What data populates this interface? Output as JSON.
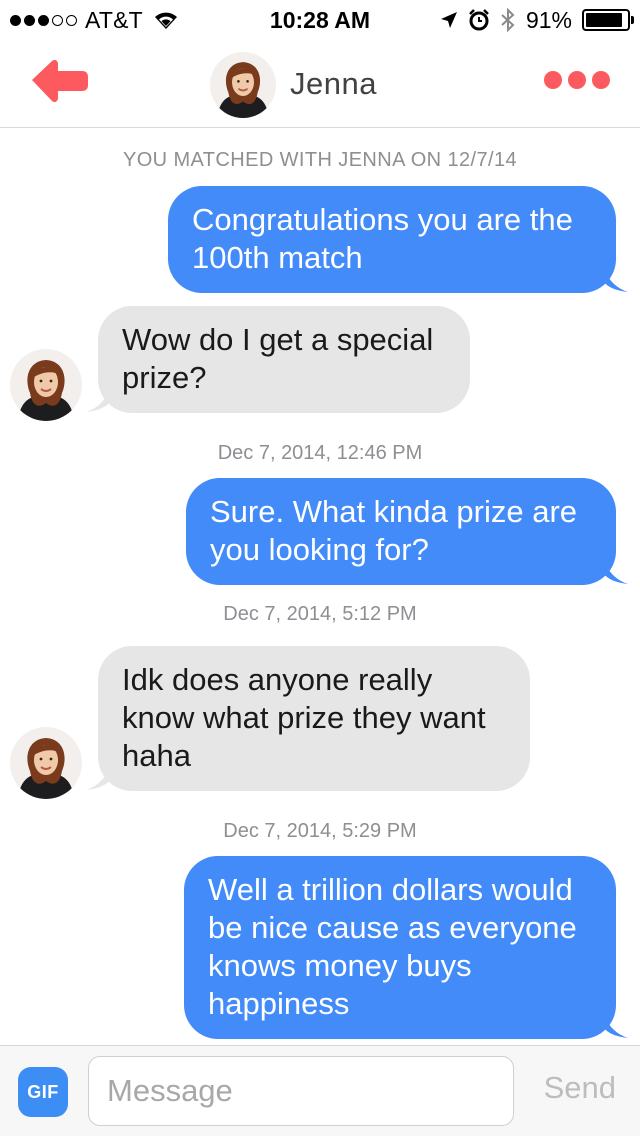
{
  "status_bar": {
    "carrier": "AT&T",
    "time": "10:28 AM",
    "battery": "91%",
    "battery_level": 0.91,
    "signal_bars_filled": 3,
    "signal_bars_total": 5
  },
  "header": {
    "name": "Jenna",
    "back_icon": "back-arrow-icon",
    "more_icon": "more-dots-icon"
  },
  "chat": {
    "match_notice": "YOU MATCHED WITH JENNA ON 12/7/14",
    "messages": [
      {
        "from": "me",
        "text": "Congratulations you are the 100th match"
      },
      {
        "from": "them",
        "text": "Wow do I get a special prize?"
      },
      {
        "from": "me",
        "text": "Sure. What kinda prize are you looking for?"
      },
      {
        "from": "them",
        "text": "Idk does anyone really know what prize they want haha"
      },
      {
        "from": "me",
        "text": "Well a trillion dollars would be nice cause as everyone knows money buys happiness"
      }
    ],
    "timestamps": [
      "Dec 7, 2014, 12:46 PM",
      "Dec 7, 2014, 5:12 PM",
      "Dec 7, 2014, 5:29 PM"
    ]
  },
  "input_bar": {
    "gif_label": "GIF",
    "placeholder": "Message",
    "send_label": "Send"
  },
  "colors": {
    "accent": "#fd5a5f",
    "outgoing_bubble": "#428bf9",
    "incoming_bubble": "#e6e6e6",
    "gif_button": "#3d8ef4"
  }
}
